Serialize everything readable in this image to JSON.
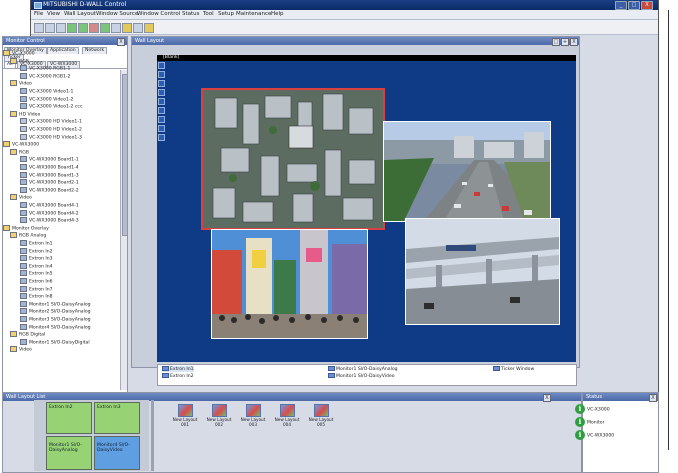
{
  "app": {
    "title": "MITSUBISHI D-WALL Control",
    "window_buttons": [
      "_",
      "□",
      "X"
    ]
  },
  "menu": [
    "File",
    "View",
    "Wall Layout",
    "Window Source",
    "Window Control",
    "Status",
    "Tool",
    "Setup",
    "Maintenance",
    "Help"
  ],
  "monitor_control": {
    "title": "Monitor Control",
    "close": "X",
    "tabs_row1": [
      "Monitor Overlay",
      "Application",
      "Network"
    ],
    "tabs_row2": [
      "Ticker"
    ],
    "tabs_row3": [
      "All",
      "VC-X3000",
      "VC-WX3000"
    ],
    "tree": [
      {
        "label": "VC-X3000",
        "indent": 0,
        "type": "folder"
      },
      {
        "label": "RGB",
        "indent": 1,
        "type": "folder"
      },
      {
        "label": "VC-X3000 RGB1-1",
        "indent": 2,
        "type": "dev"
      },
      {
        "label": "VC-X3000 RGB1-2",
        "indent": 2,
        "type": "dev"
      },
      {
        "label": "Video",
        "indent": 1,
        "type": "folder"
      },
      {
        "label": "VC-X3000 Video1-1",
        "indent": 2,
        "type": "dev"
      },
      {
        "label": "VC-X3000 Video1-2",
        "indent": 2,
        "type": "dev"
      },
      {
        "label": "VC-X3000 Video1-2 ccc",
        "indent": 2,
        "type": "dev"
      },
      {
        "label": "HD Video",
        "indent": 1,
        "type": "folder"
      },
      {
        "label": "VC-X3000 HD Video1-1",
        "indent": 2,
        "type": "vid"
      },
      {
        "label": "VC-X3000 HD Video1-2",
        "indent": 2,
        "type": "vid"
      },
      {
        "label": "VC-X3000 HD Video1-3",
        "indent": 2,
        "type": "vid"
      },
      {
        "label": "VC-WX3000",
        "indent": 0,
        "type": "folder"
      },
      {
        "label": "RGB",
        "indent": 1,
        "type": "folder"
      },
      {
        "label": "VC-WX3000 Board1-1",
        "indent": 2,
        "type": "dev"
      },
      {
        "label": "VC-WX3000 Board1-4",
        "indent": 2,
        "type": "dev"
      },
      {
        "label": "VC-WX3000 Board1-3",
        "indent": 2,
        "type": "dev"
      },
      {
        "label": "VC-WX3000 Board2-1",
        "indent": 2,
        "type": "dev"
      },
      {
        "label": "VC-WX3000 Board2-2",
        "indent": 2,
        "type": "dev"
      },
      {
        "label": "Video",
        "indent": 1,
        "type": "folder"
      },
      {
        "label": "VC-WX3000 Board4-1",
        "indent": 2,
        "type": "dev"
      },
      {
        "label": "VC-WX3000 Board4-2",
        "indent": 2,
        "type": "dev"
      },
      {
        "label": "VC-WX3000 Board4-3",
        "indent": 2,
        "type": "dev"
      },
      {
        "label": "Monitor Overlay",
        "indent": 0,
        "type": "folder"
      },
      {
        "label": "RGB Analog",
        "indent": 1,
        "type": "folder"
      },
      {
        "label": "Extron In1",
        "indent": 2,
        "type": "dev"
      },
      {
        "label": "Extron In2",
        "indent": 2,
        "type": "dev"
      },
      {
        "label": "Extron In3",
        "indent": 2,
        "type": "dev"
      },
      {
        "label": "Extron In4",
        "indent": 2,
        "type": "dev"
      },
      {
        "label": "Extron In5",
        "indent": 2,
        "type": "dev"
      },
      {
        "label": "Extron In6",
        "indent": 2,
        "type": "dev"
      },
      {
        "label": "Extron In7",
        "indent": 2,
        "type": "dev"
      },
      {
        "label": "Extron In8",
        "indent": 2,
        "type": "dev"
      },
      {
        "label": "Monitor1 Sl/O-DaisyAnalog",
        "indent": 2,
        "type": "dev"
      },
      {
        "label": "Monitor2 Sl/O-DaisyAnalog",
        "indent": 2,
        "type": "dev"
      },
      {
        "label": "Monitor3 Sl/O-DaisyAnalog",
        "indent": 2,
        "type": "dev"
      },
      {
        "label": "Monitor4 Sl/O-DaisyAnalog",
        "indent": 2,
        "type": "dev"
      },
      {
        "label": "RGB Digital",
        "indent": 1,
        "type": "folder"
      },
      {
        "label": "Monitor1 Sl/O-DaisyDigital",
        "indent": 2,
        "type": "dev"
      },
      {
        "label": "Video",
        "indent": 1,
        "type": "folder"
      }
    ]
  },
  "wall_layout": {
    "title": "Wall Layout",
    "buttons": [
      "□",
      "+",
      "X"
    ],
    "canvas_header": "[Blank]",
    "sources": [
      {
        "label": "Extron In1",
        "col": 0,
        "row": 0,
        "selected": true
      },
      {
        "label": "Extron In2",
        "col": 0,
        "row": 1,
        "selected": false
      },
      {
        "label": "Monitor1 Sl/O-DaisyAnalog",
        "col": 1,
        "row": 0,
        "selected": false
      },
      {
        "label": "Monitor1 Sl/O-DaisyVideo",
        "col": 1,
        "row": 1,
        "selected": false
      },
      {
        "label": "Ticker Window",
        "col": 2,
        "row": 0,
        "selected": false
      }
    ]
  },
  "layout_list": {
    "title": "Wall Layout List",
    "close": "X",
    "wall_cells": [
      {
        "label": "Extron In2",
        "color": "green"
      },
      {
        "label": "Extron In3",
        "color": "green"
      },
      {
        "label": "Monitor1 Sl/O-DaisyAnalog",
        "color": "green"
      },
      {
        "label": "Monitor4 Sl/O-DaisyVideo",
        "color": "blue"
      }
    ],
    "items": [
      {
        "label": "New Layout 001"
      },
      {
        "label": "New Layout 002"
      },
      {
        "label": "New Layout 003"
      },
      {
        "label": "New Layout 004"
      },
      {
        "label": "New Layout 005"
      }
    ]
  },
  "status": {
    "title": "Status",
    "close": "X",
    "items": [
      {
        "label": "VC-X3000",
        "icon": "info-icon"
      },
      {
        "label": "Monitor",
        "icon": "info-icon"
      },
      {
        "label": "VC-WX3000",
        "icon": "info-icon"
      }
    ]
  },
  "colors": {
    "canvas": "#0f3a86",
    "selection": "#d94040",
    "status_ok": "#2e9e3e"
  }
}
